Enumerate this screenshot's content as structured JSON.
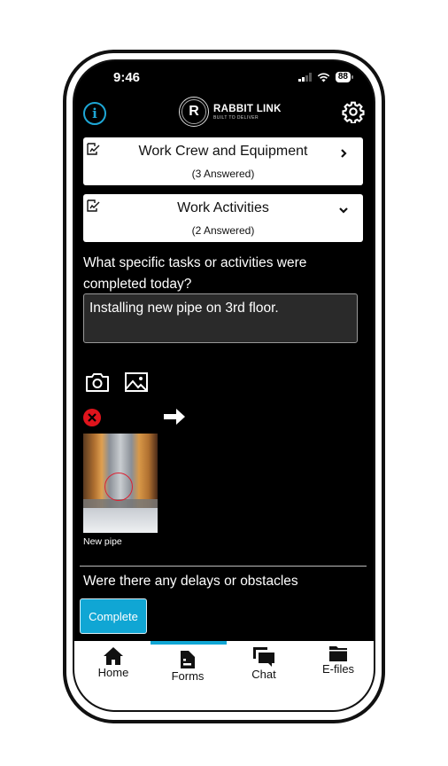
{
  "status_bar": {
    "time": "9:46",
    "battery": "88"
  },
  "header": {
    "brand_name": "RABBIT LINK",
    "brand_tagline": "BUILT TO DELIVER",
    "logo_letter": "R"
  },
  "sections": [
    {
      "title": "Work Crew and Equipment",
      "subtitle": "(3 Answered)",
      "state": "collapsed"
    },
    {
      "title": "Work Activities",
      "subtitle": "(2 Answered)",
      "state": "expanded"
    }
  ],
  "questions": [
    {
      "label": "What specific tasks or activities were completed today?",
      "answer": "Installing new pipe on 3rd floor."
    },
    {
      "label": "Were there any delays or obstacles"
    }
  ],
  "attachment": {
    "caption": "New pipe"
  },
  "actions": {
    "complete_label": "Complete"
  },
  "colors": {
    "accent": "#10a6d4",
    "remove": "#e0141c",
    "info": "#1ea7d6"
  },
  "tabbar": {
    "active": "Forms",
    "items": [
      {
        "label": "Home",
        "icon": "home-icon"
      },
      {
        "label": "Forms",
        "icon": "forms-icon"
      },
      {
        "label": "Chat",
        "icon": "chat-icon"
      },
      {
        "label": "E-files",
        "icon": "folder-icon"
      }
    ]
  }
}
